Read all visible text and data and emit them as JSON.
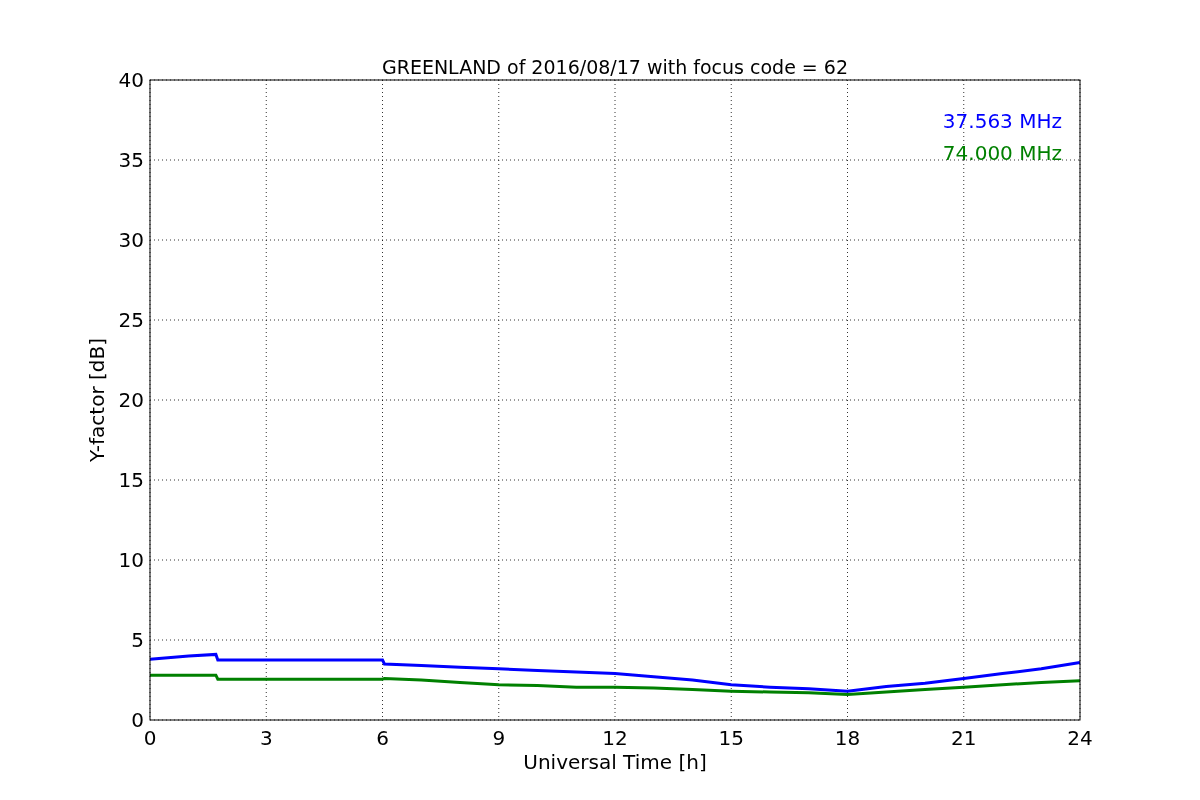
{
  "figure": {
    "chart_data": {
      "type": "line",
      "title": "GREENLAND of 2016/08/17 with focus code = 62",
      "xlabel": "Universal Time [h]",
      "ylabel": "Y-factor [dB]",
      "x": [
        0,
        1,
        1.7,
        1.75,
        6,
        6.05,
        7,
        8,
        9,
        10,
        11,
        12,
        13,
        14,
        15,
        16,
        17,
        18,
        19,
        20,
        21,
        22,
        23,
        24
      ],
      "series": [
        {
          "name": "37.563 MHz",
          "color": "#0000ff",
          "values": [
            3.8,
            4.0,
            4.1,
            3.75,
            3.75,
            3.5,
            3.4,
            3.3,
            3.2,
            3.1,
            3.0,
            2.9,
            2.7,
            2.5,
            2.2,
            2.05,
            1.95,
            1.8,
            2.1,
            2.3,
            2.6,
            2.9,
            3.2,
            3.6
          ]
        },
        {
          "name": "74.000 MHz",
          "color": "#008000",
          "values": [
            2.8,
            2.8,
            2.8,
            2.55,
            2.55,
            2.6,
            2.5,
            2.35,
            2.2,
            2.15,
            2.05,
            2.05,
            2.0,
            1.9,
            1.8,
            1.75,
            1.7,
            1.6,
            1.75,
            1.9,
            2.05,
            2.2,
            2.35,
            2.45
          ]
        }
      ],
      "xlim": [
        0,
        24
      ],
      "ylim": [
        0,
        40
      ],
      "xticks": [
        0,
        3,
        6,
        9,
        12,
        15,
        18,
        21,
        24
      ],
      "yticks": [
        0,
        5,
        10,
        15,
        20,
        25,
        30,
        35,
        40
      ],
      "grid": true
    }
  }
}
